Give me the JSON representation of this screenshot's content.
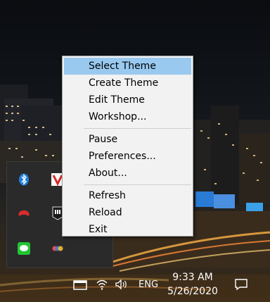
{
  "context_menu": {
    "items": [
      {
        "label": "Select Theme",
        "selected": true
      },
      {
        "label": "Create Theme"
      },
      {
        "label": "Edit Theme"
      },
      {
        "label": "Workshop..."
      },
      {
        "label": "Pause"
      },
      {
        "label": "Preferences..."
      },
      {
        "label": "About..."
      },
      {
        "label": "Refresh"
      },
      {
        "label": "Reload"
      },
      {
        "label": "Exit"
      }
    ],
    "highlight_color": "#99c9ef",
    "background_color": "#f2f2f2"
  },
  "tray_overflow": {
    "icons": [
      "bluetooth-icon",
      "app-v-icon",
      "controller-app-icon",
      "epic-games-icon",
      "line-chat-icon",
      "multicolor-app-icon"
    ]
  },
  "taskbar": {
    "language": "ENG",
    "time": "9:33 AM",
    "date": "5/26/2020",
    "icons": [
      "tray-window-icon",
      "wifi-icon",
      "volume-icon",
      "notification-icon"
    ]
  }
}
